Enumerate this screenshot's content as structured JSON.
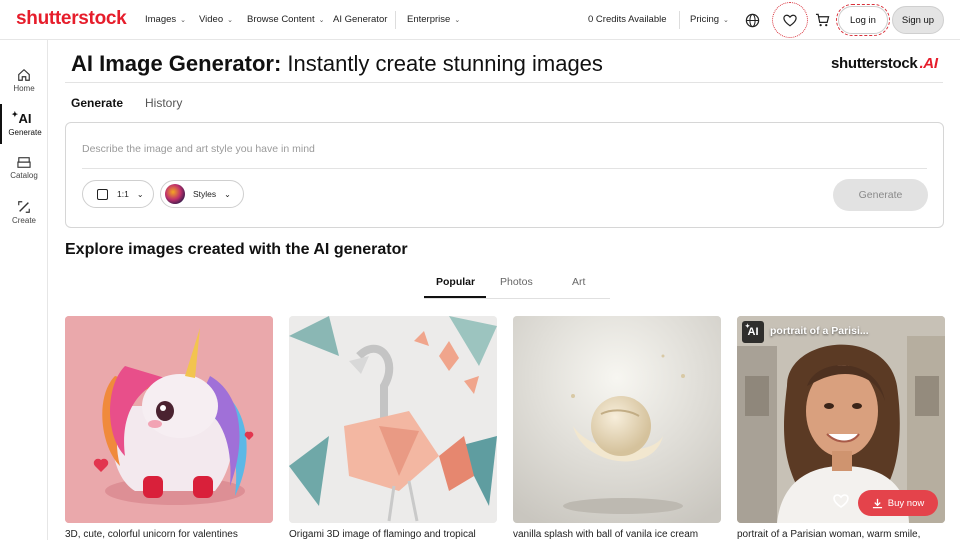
{
  "topnav": {
    "logo": "shutterstock",
    "items": [
      {
        "label": "Images"
      },
      {
        "label": "Video"
      },
      {
        "label": "Browse Content"
      },
      {
        "label": "AI Generator"
      },
      {
        "label": "Enterprise"
      }
    ],
    "credits": "0 Credits Available",
    "pricing": "Pricing",
    "login": "Log in",
    "signup": "Sign up",
    "icons": [
      "globe-icon",
      "heart-icon",
      "cart-icon"
    ]
  },
  "sidebar": {
    "items": [
      {
        "label": "Home",
        "icon": "home-icon"
      },
      {
        "label": "Generate",
        "icon": "sparkle-ai-icon",
        "badge": "AI"
      },
      {
        "label": "Catalog",
        "icon": "catalog-icon"
      },
      {
        "label": "Create",
        "icon": "create-icon"
      }
    ]
  },
  "header": {
    "title_bold": "AI Image Generator:",
    "title_rest": "Instantly create stunning images",
    "brand": "shutterstock",
    "brand_ai": ".AI"
  },
  "tabs": [
    {
      "label": "Generate",
      "active": true
    },
    {
      "label": "History",
      "active": false
    }
  ],
  "generator": {
    "placeholder": "Describe the image and art style you have in mind",
    "ratio": "1:1",
    "styles": "Styles",
    "generate_label": "Generate"
  },
  "explore": {
    "title": "Explore images created with the AI generator",
    "tabs": [
      {
        "label": "Popular",
        "active": true
      },
      {
        "label": "Photos",
        "active": false
      },
      {
        "label": "Art",
        "active": false
      }
    ],
    "cards": [
      {
        "caption": "3D, cute, colorful unicorn for valentines"
      },
      {
        "caption": "Origami 3D image of flamingo and tropical"
      },
      {
        "caption": "vanilla splash with ball of vanila ice cream"
      },
      {
        "caption": "portrait of a Parisian woman, warm smile,",
        "overlay_title": "portrait of a Parisi...",
        "ai_badge": "AI",
        "buy_label": "Buy now"
      }
    ]
  },
  "colors": {
    "brand_red": "#e61d2b",
    "buy_red": "#e4434b",
    "disabled_grey": "#e2e2e2"
  }
}
